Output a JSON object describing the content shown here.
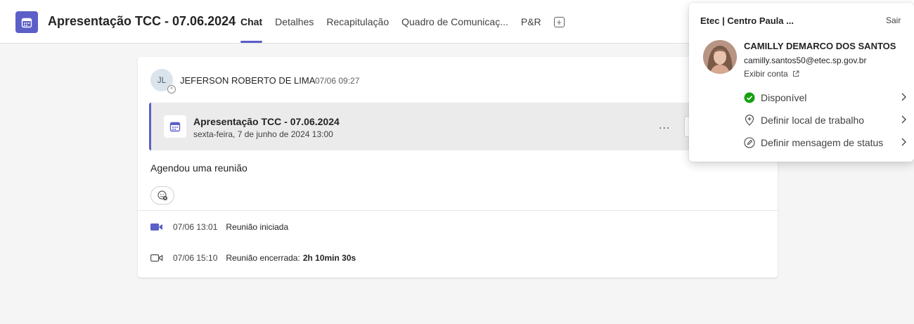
{
  "header": {
    "title": "Apresentação TCC - 07.06.2024",
    "tabs": [
      {
        "label": "Chat"
      },
      {
        "label": "Detalhes"
      },
      {
        "label": "Recapitulação"
      },
      {
        "label": "Quadro de Comunicaç..."
      },
      {
        "label": "P&R"
      }
    ],
    "add_tab_glyph": "+"
  },
  "message": {
    "avatar_initials": "JL",
    "sender": "JEFERSON ROBERTO DE LIMA",
    "time": "07/06 09:27",
    "meeting": {
      "title": "Apresentação TCC - 07.06.2024",
      "date": "sexta-feira, 7 de junho de 2024 13:00",
      "more_label": "..."
    },
    "body": "Agendou uma reunião"
  },
  "events": [
    {
      "time": "07/06 13:01",
      "text": "Reunião iniciada",
      "duration": ""
    },
    {
      "time": "07/06 15:10",
      "text": "Reunião encerrada:",
      "duration": "2h 10min 30s"
    }
  ],
  "profile": {
    "org": "Etec | Centro Paula ...",
    "signout": "Sair",
    "name": "CAMILLY DEMARCO DOS SANTOS",
    "email": "camilly.santos50@etec.sp.gov.br",
    "view_account": "Exibir conta",
    "menu": [
      {
        "label": "Disponível",
        "icon": "available-icon"
      },
      {
        "label": "Definir local de trabalho",
        "icon": "location-icon"
      },
      {
        "label": "Definir mensagem de status",
        "icon": "edit-status-icon"
      }
    ]
  },
  "colors": {
    "accent": "#5b5fc7",
    "available": "#13a10e"
  }
}
